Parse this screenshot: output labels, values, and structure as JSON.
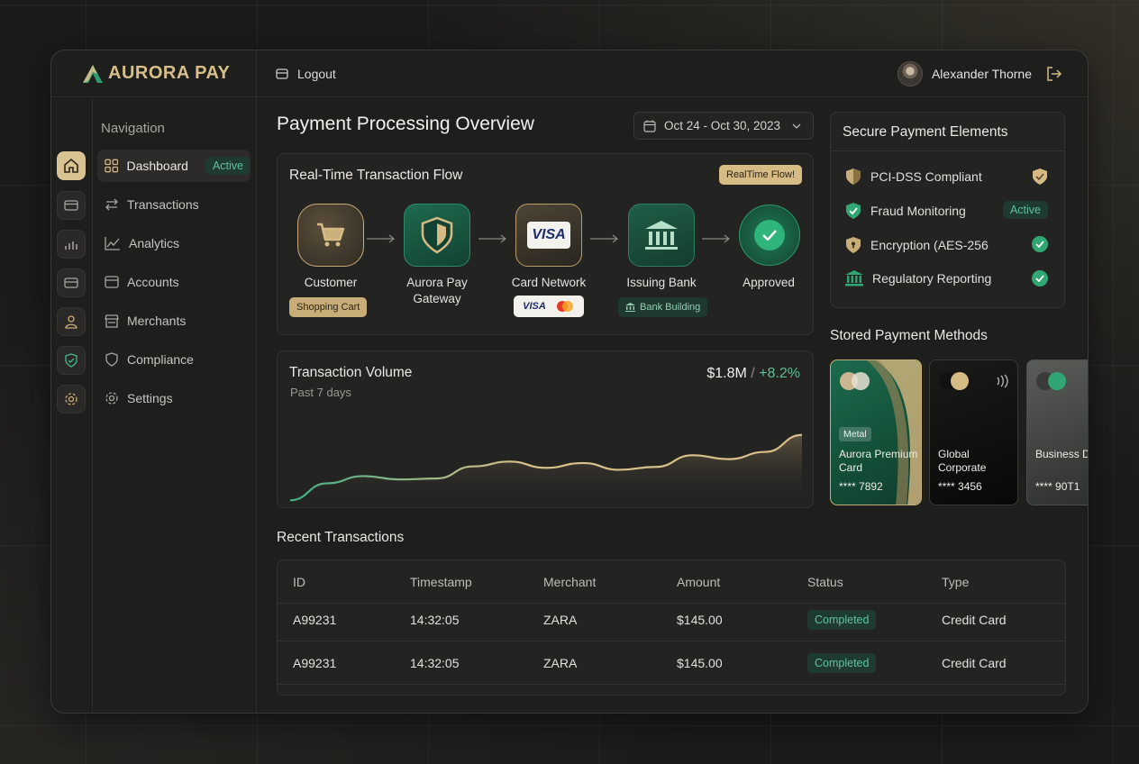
{
  "brand": {
    "name": "AURORA PAY"
  },
  "topbar": {
    "logout_label": "Logout",
    "user_name": "Alexander Thorne"
  },
  "sidebar": {
    "title": "Navigation",
    "active_badge": "Active",
    "items": [
      {
        "label": "Dashboard",
        "icon": "grid-icon"
      },
      {
        "label": "Transactions",
        "icon": "swap-icon"
      },
      {
        "label": "Analytics",
        "icon": "line-chart-icon"
      },
      {
        "label": "Accounts",
        "icon": "wallet-icon"
      },
      {
        "label": "Merchants",
        "icon": "store-icon"
      },
      {
        "label": "Compliance",
        "icon": "shield-icon"
      },
      {
        "label": "Settings",
        "icon": "gear-icon"
      }
    ]
  },
  "main": {
    "title": "Payment Processing Overview",
    "date_range": "Oct 24 - Oct 30, 2023"
  },
  "flow": {
    "title": "Real-Time Transaction Flow",
    "badge": "RealTime Flow!",
    "nodes": [
      {
        "label": "Customer",
        "icon": "cart-icon"
      },
      {
        "label": "Aurora Pay",
        "label2": "Gateway",
        "icon": "shield-icon"
      },
      {
        "label": "Card Network",
        "icon": "visa-card-icon",
        "icon_text": "VISA"
      },
      {
        "label": "Issuing Bank",
        "icon": "bank-icon"
      },
      {
        "label": "Approved",
        "icon": "check-icon"
      }
    ],
    "shopping_cart_pill": "Shopping Cart",
    "network_logo": "VISA",
    "bank_pill": "Bank Building"
  },
  "volume": {
    "title": "Transaction Volume",
    "subtitle": "Past 7 days",
    "value": "$1.8M",
    "separator": "/",
    "change": "+8.2%"
  },
  "chart_data": {
    "type": "area",
    "title": "Transaction Volume",
    "x": [
      0,
      1,
      2,
      3,
      4,
      5,
      6,
      7,
      8,
      9,
      10,
      11,
      12,
      13,
      14
    ],
    "values": [
      5,
      40,
      55,
      48,
      50,
      75,
      85,
      72,
      82,
      68,
      74,
      98,
      90,
      105,
      140
    ],
    "colors": {
      "start": "#3fae84",
      "end": "#d9c08a"
    },
    "ylim": [
      0,
      160
    ],
    "grid": false
  },
  "secure": {
    "title": "Secure Payment Elements",
    "active_label": "Active",
    "rows": [
      {
        "label": "PCI-DSS Compliant",
        "icon": "shield-icon",
        "status": "shield"
      },
      {
        "label": "Fraud Monitoring",
        "icon": "shield-check-icon",
        "status": "badge"
      },
      {
        "label": "Encryption (AES-256",
        "icon": "lock-shield-icon",
        "status": "check"
      },
      {
        "label": "Regulatory Reporting",
        "icon": "bank-icon",
        "status": "check"
      }
    ]
  },
  "stored": {
    "title": "Stored Payment Methods",
    "cards": [
      {
        "tag": "Metal",
        "name": "Aurora Premium Card",
        "number": "**** 7892"
      },
      {
        "tag": "",
        "name": "Global Corporate",
        "number": "**** 3456"
      },
      {
        "tag": "",
        "name": "Business Debit",
        "number": "**** 90T1"
      }
    ]
  },
  "transactions": {
    "title": "Recent Transactions",
    "columns": [
      "ID",
      "Timestamp",
      "Merchant",
      "Amount",
      "Status",
      "Type"
    ],
    "rows": [
      [
        "A99231",
        "14:32:05",
        "ZARA",
        "$145.00",
        "Completed",
        "Credit Card"
      ],
      [
        "A99231",
        "14:32:05",
        "ZARA",
        "$145.00",
        "Completed",
        "Credit Card"
      ]
    ]
  }
}
